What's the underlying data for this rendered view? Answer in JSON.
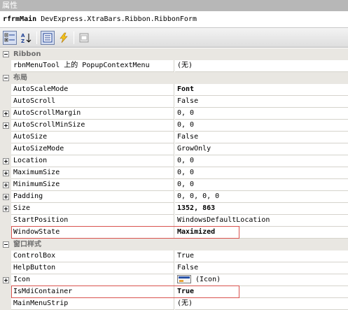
{
  "title": "属性",
  "object_selector": {
    "name": "rfrmMain",
    "type": "DevExpress.XtraBars.Ribbon.RibbonForm"
  },
  "toolbar": {
    "categorized_icon": "categorized-icon",
    "alphabetical_icon": "alphabetical-icon",
    "properties_icon": "properties-icon",
    "events_icon": "events-lightning-icon",
    "property_pages_icon": "property-pages-icon"
  },
  "grid": {
    "cat_ribbon": "Ribbon",
    "cat_layout": "布局",
    "cat_window_style": "窗口样式",
    "r01": {
      "name": "rbnMenuTool 上的 PopupContextMenu",
      "value": "(无)"
    },
    "r02": {
      "name": "AutoScaleMode",
      "value": "Font"
    },
    "r03": {
      "name": "AutoScroll",
      "value": "False"
    },
    "r04": {
      "name": "AutoScrollMargin",
      "value": "0, 0"
    },
    "r05": {
      "name": "AutoScrollMinSize",
      "value": "0, 0"
    },
    "r06": {
      "name": "AutoSize",
      "value": "False"
    },
    "r07": {
      "name": "AutoSizeMode",
      "value": "GrowOnly"
    },
    "r08": {
      "name": "Location",
      "value": "0, 0"
    },
    "r09": {
      "name": "MaximumSize",
      "value": "0, 0"
    },
    "r10": {
      "name": "MinimumSize",
      "value": "0, 0"
    },
    "r11": {
      "name": "Padding",
      "value": "0, 0, 0, 0"
    },
    "r12": {
      "name": "Size",
      "value": "1352, 863"
    },
    "r13": {
      "name": "StartPosition",
      "value": "WindowsDefaultLocation"
    },
    "r14": {
      "name": "WindowState",
      "value": "Maximized"
    },
    "r15": {
      "name": "ControlBox",
      "value": "True"
    },
    "r16": {
      "name": "HelpButton",
      "value": "False"
    },
    "r17": {
      "name": "Icon",
      "value": "(Icon)"
    },
    "r18": {
      "name": "IsMdiContainer",
      "value": "True"
    },
    "r19": {
      "name": "MainMenuStrip",
      "value": "(无)"
    }
  },
  "colors": {
    "highlight": "#d9534f",
    "category_bg": "#e9e7e2",
    "title_bg": "#b7b7b7"
  }
}
